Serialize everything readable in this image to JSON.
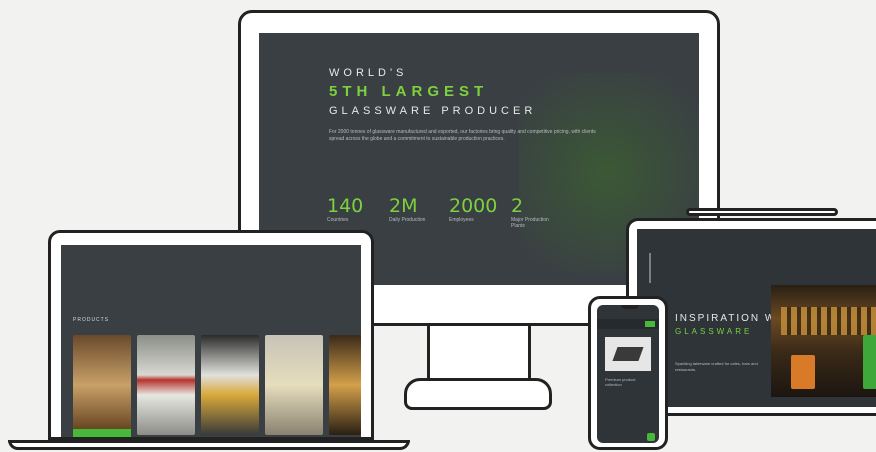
{
  "desktop": {
    "line1": "WORLD'S",
    "line2": "5TH LARGEST",
    "line3": "GLASSWARE PRODUCER",
    "paragraph": "For 2000 tonnes of glassware manufactured and exported, our factories bring quality and competitive pricing, with clients spread across the globe and a commitment to sustainable production practices.",
    "stats": [
      {
        "value": "140",
        "label": "Countries"
      },
      {
        "value": "2M",
        "label": "Daily Production"
      },
      {
        "value": "2000",
        "label": "Employees"
      },
      {
        "value": "2",
        "label": "Major Production Plants"
      }
    ]
  },
  "laptop": {
    "section_label": "PRODUCTS"
  },
  "tablet": {
    "heading": "INSPIRATION WITH",
    "subheading": "GLASSWARE",
    "paragraph": "Sparkling tableware crafted for cafes, bars and restaurants."
  },
  "phone": {
    "caption": "Premium product collection"
  },
  "colors": {
    "accent": "#7dd13e",
    "screen_bg": "#3a3f44",
    "button_green": "#48b83a"
  }
}
